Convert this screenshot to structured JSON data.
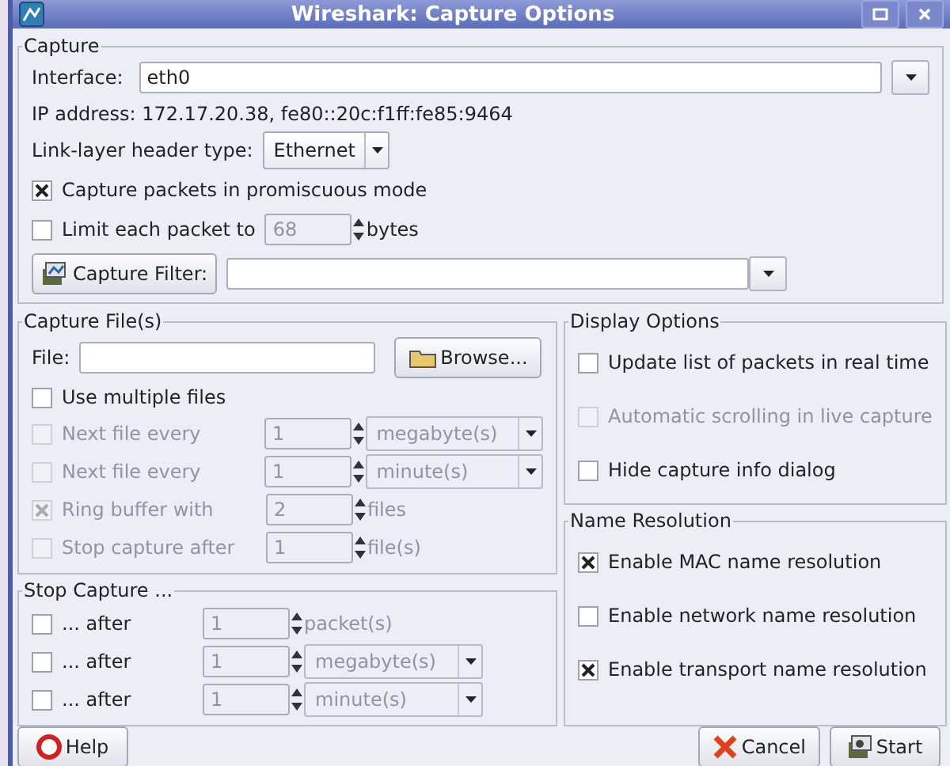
{
  "window": {
    "title": "Wireshark: Capture Options"
  },
  "capture": {
    "legend": "Capture",
    "interface_label": "Interface:",
    "interface": "eth0",
    "ip_address": "IP address: 172.17.20.38, fe80::20c:f1ff:fe85:9464",
    "link_label": "Link-layer header type:",
    "link_type": "Ethernet",
    "promiscuous": {
      "label": "Capture packets in promiscuous mode",
      "checked": true
    },
    "limit": {
      "label": "Limit each packet to",
      "checked": false,
      "value": "68",
      "field_disabled": true,
      "unit": "bytes"
    },
    "filter_button": "Capture Filter:"
  },
  "capture_files": {
    "legend": "Capture File(s)",
    "file_label": "File:",
    "browse": "Browse...",
    "multiple": {
      "label": "Use multiple files",
      "checked": false
    },
    "rows": [
      {
        "label": "Next file every",
        "checked": false,
        "disabled": true,
        "field_disabled": true,
        "value": "1",
        "unit": "megabyte(s)",
        "kind": "combo"
      },
      {
        "label": "Next file every",
        "checked": false,
        "disabled": true,
        "field_disabled": true,
        "value": "1",
        "unit": "minute(s)",
        "kind": "combo"
      },
      {
        "label": "Ring buffer with",
        "checked": true,
        "disabled": true,
        "field_disabled": true,
        "value": "2",
        "unit": "files",
        "kind": "text"
      },
      {
        "label": "Stop capture after",
        "checked": false,
        "disabled": true,
        "field_disabled": true,
        "value": "1",
        "unit": "file(s)",
        "kind": "text"
      }
    ]
  },
  "stop_capture": {
    "legend": "Stop Capture ...",
    "rows": [
      {
        "label": "... after",
        "checked": false,
        "disabled": false,
        "field_disabled": true,
        "value": "1",
        "unit": "packet(s)",
        "kind": "text"
      },
      {
        "label": "... after",
        "checked": false,
        "disabled": false,
        "field_disabled": true,
        "value": "1",
        "unit": "megabyte(s)",
        "kind": "combo"
      },
      {
        "label": "... after",
        "checked": false,
        "disabled": false,
        "field_disabled": true,
        "value": "1",
        "unit": "minute(s)",
        "kind": "combo"
      }
    ]
  },
  "display_options": {
    "legend": "Display Options",
    "options": [
      {
        "label": "Update list of packets in real time",
        "checked": false,
        "disabled": false
      },
      {
        "label": "Automatic scrolling in live capture",
        "checked": false,
        "disabled": true
      },
      {
        "label": "Hide capture info dialog",
        "checked": false,
        "disabled": false
      }
    ]
  },
  "name_resolution": {
    "legend": "Name Resolution",
    "options": [
      {
        "label": "Enable MAC name resolution",
        "checked": true,
        "disabled": false
      },
      {
        "label": "Enable network name resolution",
        "checked": false,
        "disabled": false
      },
      {
        "label": "Enable transport name resolution",
        "checked": true,
        "disabled": false
      }
    ]
  },
  "buttons": [
    {
      "label": "Help",
      "kind": "help"
    },
    {
      "label": "Cancel",
      "kind": "cancel"
    },
    {
      "label": "Start",
      "kind": "start"
    }
  ]
}
